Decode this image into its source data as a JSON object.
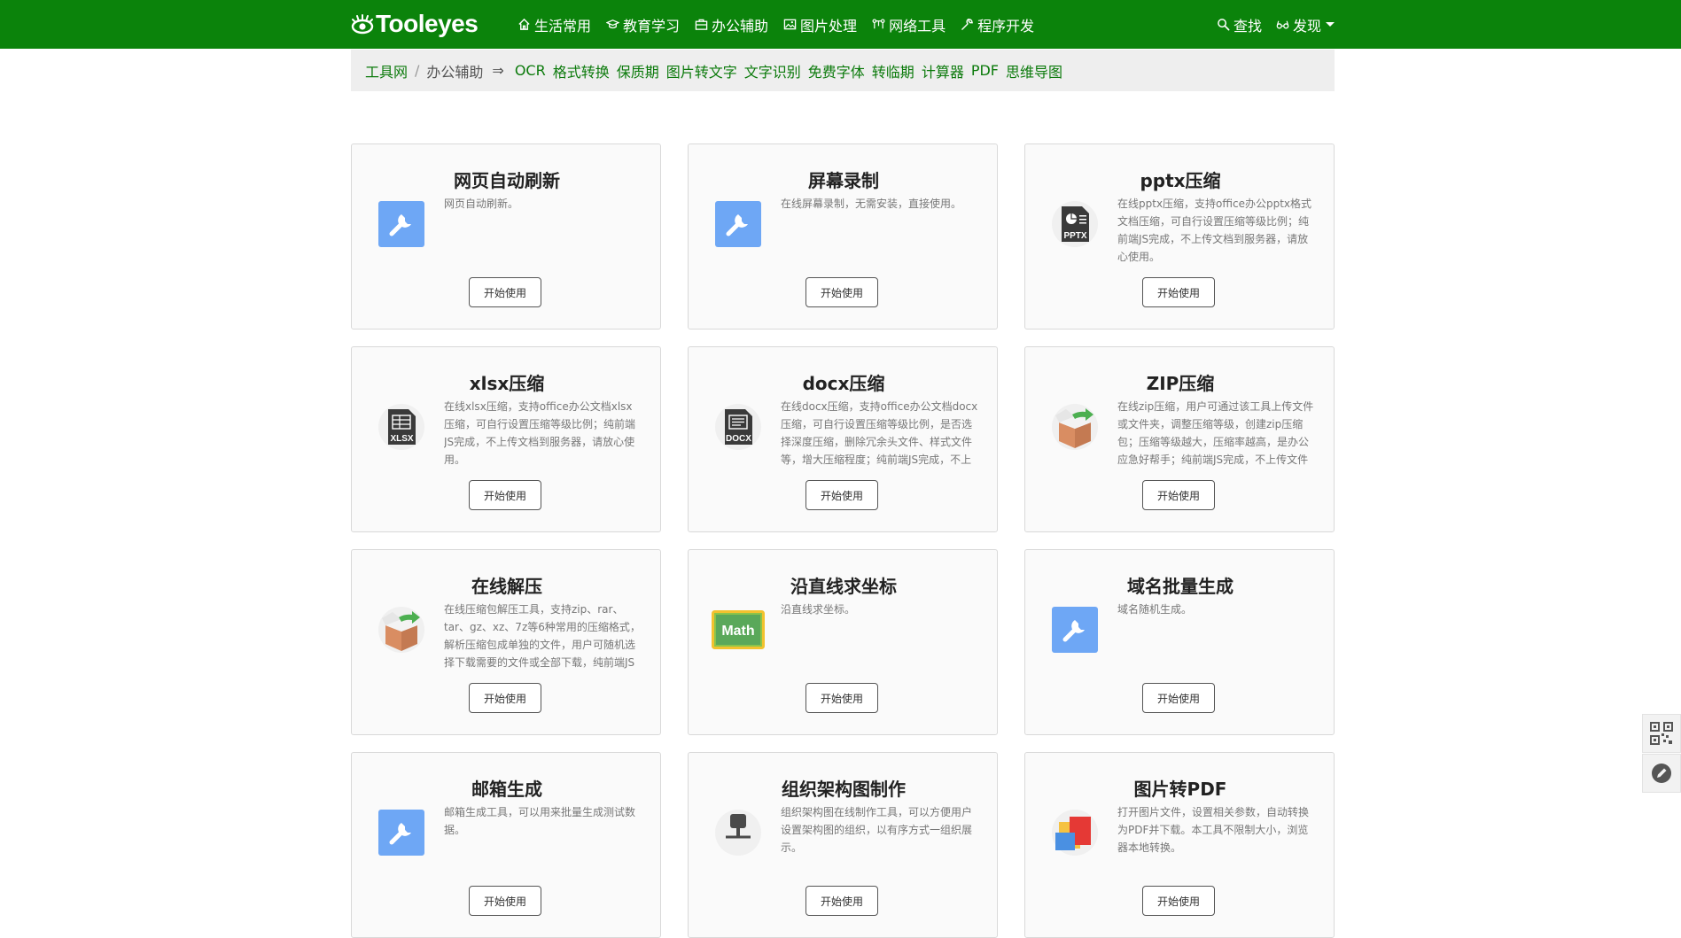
{
  "brand": {
    "name": "Tooleyes"
  },
  "nav": {
    "items": [
      {
        "label": "生活常用",
        "icon": "home-icon"
      },
      {
        "label": "教育学习",
        "icon": "graduation-cap-icon"
      },
      {
        "label": "办公辅助",
        "icon": "briefcase-icon"
      },
      {
        "label": "图片处理",
        "icon": "image-icon"
      },
      {
        "label": "网络工具",
        "icon": "network-icon"
      },
      {
        "label": "程序开发",
        "icon": "wrench-icon"
      }
    ],
    "search_label": "查找",
    "discover_label": "发现"
  },
  "breadcrumb": {
    "home": "工具网",
    "separator": "/",
    "current": "办公辅助",
    "arrow": "⇒",
    "quick_links": [
      "OCR",
      "格式转换",
      "保质期",
      "图片转文字",
      "文字识别",
      "免费字体",
      "转临期",
      "计算器",
      "PDF",
      "思维导图"
    ]
  },
  "cards": [
    {
      "title": "网页自动刷新",
      "desc": "网页自动刷新。",
      "icon": "wrench-icon",
      "button": "开始使用"
    },
    {
      "title": "屏幕录制",
      "desc": "在线屏幕录制，无需安装，直接使用。",
      "icon": "wrench-icon",
      "button": "开始使用"
    },
    {
      "title": "pptx压缩",
      "desc": "在线pptx压缩，支持office办公pptx格式文档压缩，可自行设置压缩等级比例；纯前端JS完成，不上传文档到服务器，请放心使用。",
      "icon": "pptx-file-icon",
      "icon_text": "PPTX",
      "button": "开始使用"
    },
    {
      "title": "xlsx压缩",
      "desc": "在线xlsx压缩，支持office办公文档xlsx压缩，可自行设置压缩等级比例；纯前端JS完成，不上传文档到服务器，请放心使用。",
      "icon": "xlsx-file-icon",
      "icon_text": "XLSX",
      "button": "开始使用"
    },
    {
      "title": "docx压缩",
      "desc": "在线docx压缩，支持office办公文档docx压缩，可自行设置压缩等级比例，是否选择深度压缩，删除冗余头文件、样式文件等，增大压缩程度；纯前端JS完成，不上传文档到服务器。",
      "icon": "docx-file-icon",
      "icon_text": "DOCX",
      "button": "开始使用"
    },
    {
      "title": "ZIP压缩",
      "desc": "在线zip压缩，用户可通过该工具上传文件或文件夹，调整压缩等级，创建zip压缩包；压缩等级越大，压缩率越高，是办公应急好帮手；纯前端JS完成，不上传文件到服务器。",
      "icon": "package-icon",
      "button": "开始使用"
    },
    {
      "title": "在线解压",
      "desc": "在线压缩包解压工具，支持zip、rar、tar、gz、xz、7z等6种常用的压缩格式，解析压缩包成单独的文件，用户可随机选择下载需要的文件或全部下载，纯前端JS完成。",
      "icon": "package-icon",
      "button": "开始使用"
    },
    {
      "title": "沿直线求坐标",
      "desc": "沿直线求坐标。",
      "icon": "math-icon",
      "icon_text": "Math",
      "button": "开始使用"
    },
    {
      "title": "域名批量生成",
      "desc": "域名随机生成。",
      "icon": "wrench-icon",
      "button": "开始使用"
    },
    {
      "title": "邮箱生成",
      "desc": "邮箱生成工具，可以用来批量生成测试数据。",
      "icon": "wrench-icon",
      "button": "开始使用"
    },
    {
      "title": "组织架构图制作",
      "desc": "组织架构图在线制作工具，可以方便用户设置架构图的组织，以有序方式一组织展示。",
      "icon": "org-chart-icon",
      "button": "开始使用"
    },
    {
      "title": "图片转PDF",
      "desc": "打开图片文件，设置相关参数，自动转换为PDF并下载。本工具不限制大小，浏览器本地转换。",
      "icon": "image-pdf-icon",
      "button": "开始使用"
    }
  ],
  "side_buttons": [
    {
      "icon": "qrcode-icon"
    },
    {
      "icon": "edit-icon"
    }
  ],
  "colors": {
    "header_bg": "#0b830b",
    "link": "#0b7a0b",
    "wrench_tile": "#6ea7f5"
  }
}
